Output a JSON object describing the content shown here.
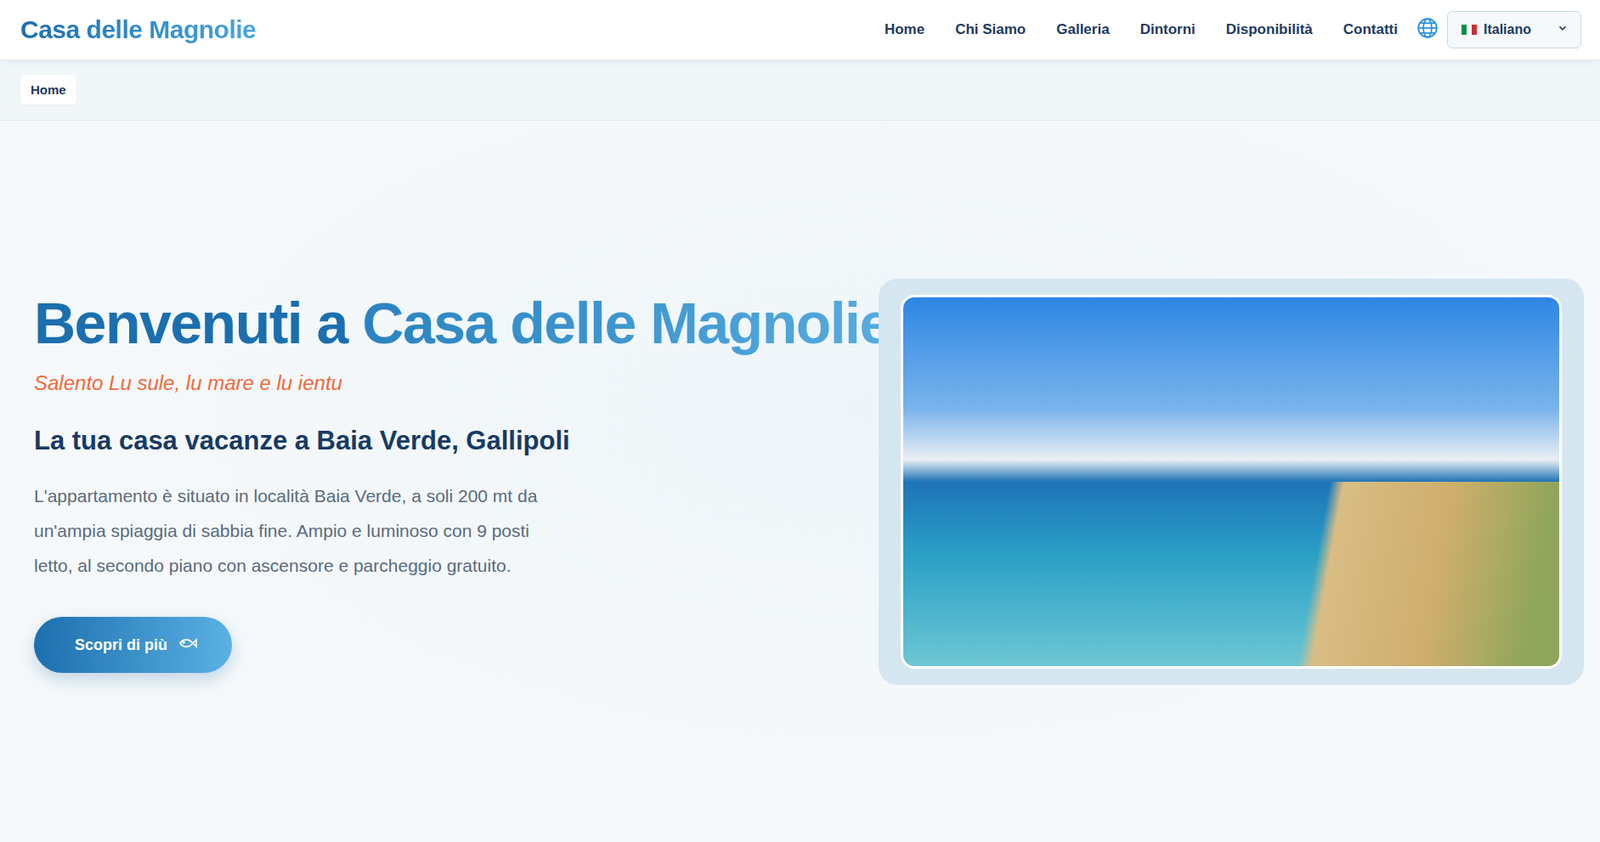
{
  "logo": "Casa delle Magnolie",
  "nav": [
    "Home",
    "Chi Siamo",
    "Galleria",
    "Dintorni",
    "Disponibilità",
    "Contatti"
  ],
  "language": {
    "label": "Italiano"
  },
  "breadcrumb": [
    "Home"
  ],
  "hero": {
    "title_lead": "Benvenuti a",
    "title_highlight": "Casa delle Magnolie",
    "tagline": "Salento Lu sule, lu mare e lu ientu",
    "heading": "La tua casa vacanze a Baia Verde, Gallipoli",
    "description": "L'appartamento è situato in località Baia Verde, a soli 200 mt da un'ampia spiaggia di sabbia fine. Ampio e luminoso con 9 posti letto, al secondo piano con ascensore e parcheggio gratuito.",
    "button": "Scopri di più"
  }
}
